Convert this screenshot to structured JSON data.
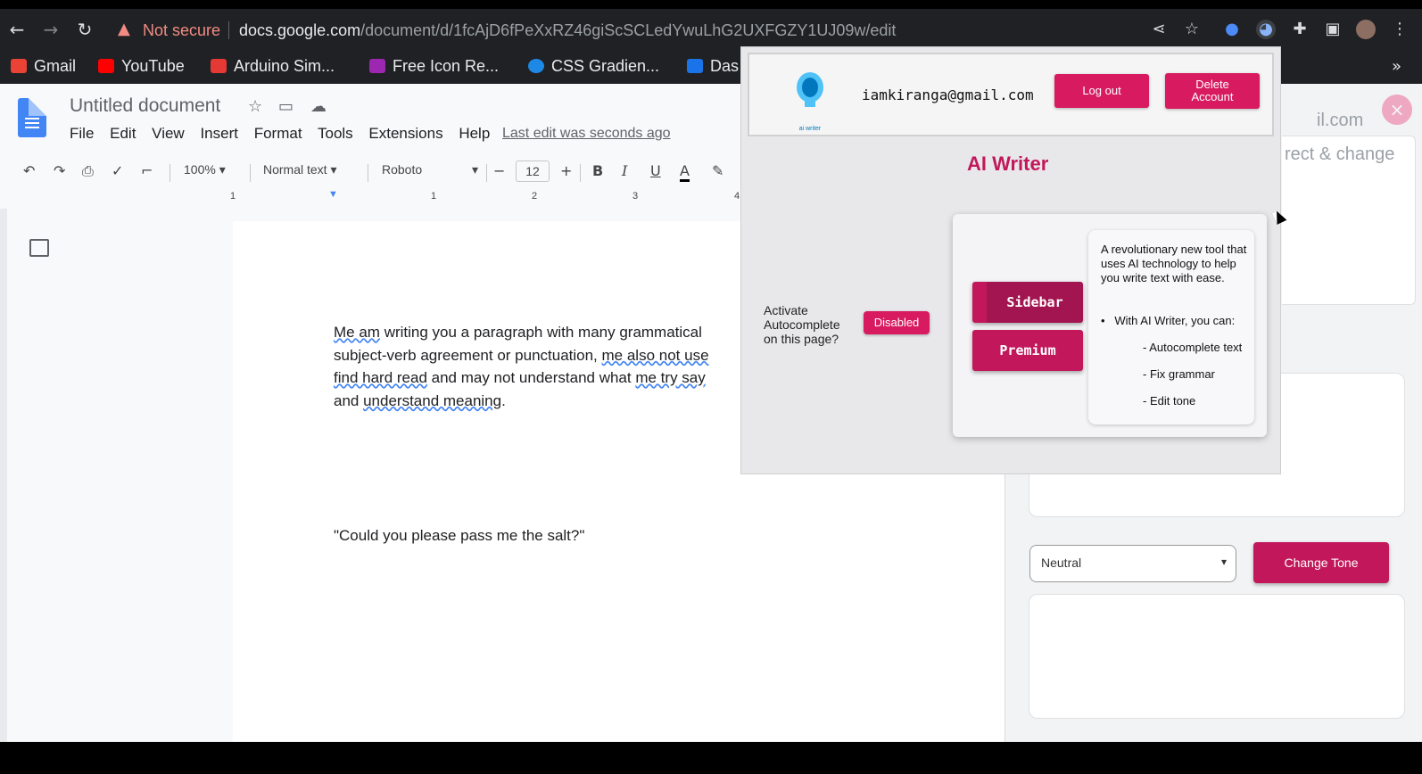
{
  "browser": {
    "security": "Not secure",
    "url_host": "docs.google.com",
    "url_path": "/document/d/1fcAjD6fPeXxRZ46giScSCLedYwuLhG2UXFGZY1UJ09w/edit"
  },
  "bookmarks": [
    {
      "label": "Gmail",
      "color": "#ea4335"
    },
    {
      "label": "YouTube",
      "color": "#ff0000"
    },
    {
      "label": "Arduino Sim...",
      "color": "#e53935"
    },
    {
      "label": "Free Icon Re...",
      "color": "#9c27b0"
    },
    {
      "label": "CSS Gradien...",
      "color": "#1e88e5"
    },
    {
      "label": "Das",
      "color": "#1a73e8"
    }
  ],
  "docs": {
    "title": "Untitled document",
    "menu": [
      "File",
      "Edit",
      "View",
      "Insert",
      "Format",
      "Tools",
      "Extensions",
      "Help"
    ],
    "last_edit": "Last edit was seconds ago",
    "toolbar": {
      "zoom": "100%",
      "style": "Normal text",
      "font": "Roboto",
      "size": "12"
    },
    "ruler_marks": [
      "1",
      "1",
      "2",
      "3",
      "4"
    ],
    "para_line1_a": "Me am",
    "para_line1_b": " writing you a paragraph with many grammatical",
    "para_line2_a": "subject-verb agreement or punctuation, ",
    "para_line2_b": "me also not use",
    "para_line3_a": "find hard read",
    "para_line3_b": " and may not understand what ",
    "para_line3_c": "me try say",
    "para_line4_a": "and ",
    "para_line4_b": "understand meaning",
    "para_line4_c": ".",
    "quote": "\"Could you please pass me the salt?\""
  },
  "sidebar": {
    "faded_email": "il.com",
    "faded_text": "rect & change",
    "tone_value": "Neutral",
    "change_tone_label": "Change Tone"
  },
  "popup": {
    "logo_caption": "ai writer",
    "email": "iamkiranga@gmail.com",
    "logout_label": "Log out",
    "delete_label_1": "Delete",
    "delete_label_2": "Account",
    "title": "AI Writer",
    "activate_label": "Activate Autocomplete on this page?",
    "disabled_label": "Disabled",
    "sidebar_btn": "Sidebar",
    "premium_btn": "Premium",
    "description": "A revolutionary new tool that uses AI technology to help you write text with ease.",
    "bullet": "With AI Writer, you can:",
    "features": [
      "- Autocomplete text",
      "- Fix grammar",
      "- Edit tone"
    ]
  },
  "colors": {
    "accent": "#c2185b",
    "docs_blue": "#4285f4"
  }
}
